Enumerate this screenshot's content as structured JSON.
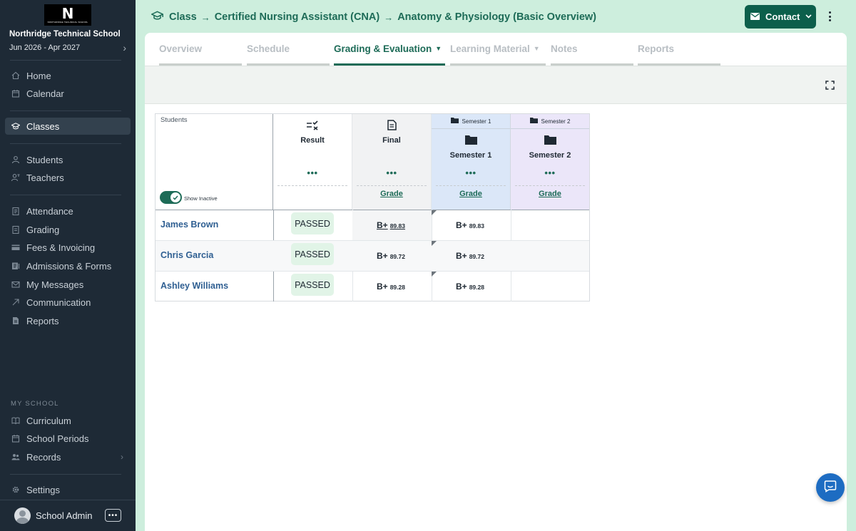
{
  "sidebar": {
    "logo_text": "N",
    "logo_subtext": "NORTHRIDGE TECHNICAL SCHOOL",
    "school_name": "Northridge Technical School",
    "period": "Jun 2026 - Apr 2027",
    "items": [
      {
        "label": "Home",
        "icon": "home-icon"
      },
      {
        "label": "Calendar",
        "icon": "calendar-icon"
      },
      {
        "label": "Classes",
        "icon": "graduation-cap-icon",
        "active": true
      },
      {
        "label": "Students",
        "icon": "user-icon"
      },
      {
        "label": "Teachers",
        "icon": "teacher-icon"
      },
      {
        "label": "Attendance",
        "icon": "clipboard-icon"
      },
      {
        "label": "Grading",
        "icon": "grading-icon"
      },
      {
        "label": "Fees & Invoicing",
        "icon": "credit-card-icon"
      },
      {
        "label": "Admissions & Forms",
        "icon": "forms-icon"
      },
      {
        "label": "My Messages",
        "icon": "mail-icon"
      },
      {
        "label": "Communication",
        "icon": "send-icon"
      },
      {
        "label": "Reports",
        "icon": "report-icon"
      }
    ],
    "section_label": "MY SCHOOL",
    "school_items": [
      {
        "label": "Curriculum",
        "icon": "book-icon"
      },
      {
        "label": "School Periods",
        "icon": "calendar-range-icon"
      },
      {
        "label": "Records",
        "icon": "records-icon"
      }
    ],
    "settings_label": "Settings",
    "user_name": "School Admin",
    "more_label": "•••"
  },
  "header": {
    "breadcrumb": [
      "Class",
      "Certified Nursing Assistant (CNA)",
      "Anatomy & Physiology (Basic Overview)"
    ],
    "contact_label": "Contact",
    "accent": "#1d6b57"
  },
  "tabs": [
    {
      "label": "Overview"
    },
    {
      "label": "Schedule"
    },
    {
      "label": "Grading & Evaluation",
      "active": true,
      "dropdown": true
    },
    {
      "label": "Learning Material",
      "dropdown": true
    },
    {
      "label": "Notes"
    },
    {
      "label": "Reports"
    }
  ],
  "table": {
    "students_header": "Students",
    "show_inactive_label": "Show Inactive",
    "show_inactive": true,
    "columns": [
      {
        "name": "Result",
        "icon": "result-checklist-icon"
      },
      {
        "name": "Final",
        "icon": "document-icon",
        "link": "Grade"
      },
      {
        "name": "Semester 1",
        "icon": "folder-icon",
        "group": "Semester 1",
        "link": "Grade"
      },
      {
        "name": "Semester 2",
        "icon": "folder-icon",
        "group": "Semester 2",
        "link": "Grade"
      }
    ],
    "rows": [
      {
        "student": "James Brown",
        "result": "PASSED",
        "final_letter": "B+",
        "final_score": "89.83",
        "sem1_letter": "B+",
        "sem1_score": "89.83"
      },
      {
        "student": "Chris Garcia",
        "result": "PASSED",
        "final_letter": "B+",
        "final_score": "89.72",
        "sem1_letter": "B+",
        "sem1_score": "89.72"
      },
      {
        "student": "Ashley Williams",
        "result": "PASSED",
        "final_letter": "B+",
        "final_score": "89.28",
        "sem1_letter": "B+",
        "sem1_score": "89.28"
      }
    ],
    "dots": "•••"
  }
}
